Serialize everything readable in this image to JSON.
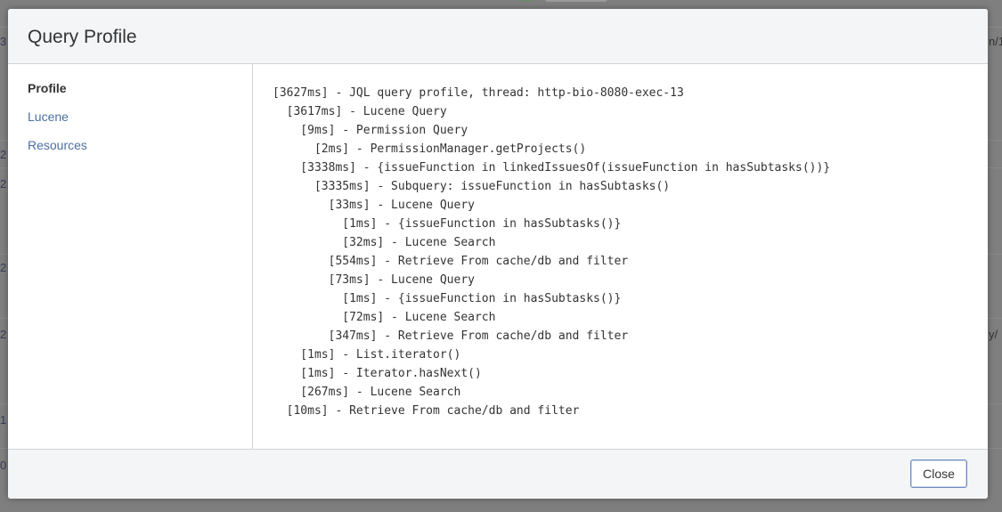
{
  "background": {
    "left_fragments": [
      "3",
      "2",
      "2",
      "2",
      "2",
      "1",
      "0"
    ],
    "right_fragments": [
      "n/1",
      "y/"
    ]
  },
  "dialog": {
    "title": "Query Profile",
    "sidebar": {
      "items": [
        {
          "label": "Profile",
          "active": true
        },
        {
          "label": "Lucene",
          "active": false
        },
        {
          "label": "Resources",
          "active": false
        }
      ]
    },
    "profile_lines": [
      "[3627ms] - JQL query profile, thread: http-bio-8080-exec-13",
      "  [3617ms] - Lucene Query",
      "    [9ms] - Permission Query",
      "      [2ms] - PermissionManager.getProjects()",
      "    [3338ms] - {issueFunction in linkedIssuesOf(issueFunction in hasSubtasks())}",
      "      [3335ms] - Subquery: issueFunction in hasSubtasks()",
      "        [33ms] - Lucene Query",
      "          [1ms] - {issueFunction in hasSubtasks()}",
      "          [32ms] - Lucene Search",
      "        [554ms] - Retrieve From cache/db and filter",
      "        [73ms] - Lucene Query",
      "          [1ms] - {issueFunction in hasSubtasks()}",
      "          [72ms] - Lucene Search",
      "        [347ms] - Retrieve From cache/db and filter",
      "    [1ms] - List.iterator()",
      "    [1ms] - Iterator.hasNext()",
      "    [267ms] - Lucene Search",
      "  [10ms] - Retrieve From cache/db and filter"
    ],
    "footer": {
      "close_label": "Close"
    }
  },
  "colors": {
    "link": "#4a6fa0",
    "text": "#333333",
    "header_bg": "#f4f5f7",
    "border": "#d0d3d8",
    "button_border": "#6e8ebc"
  }
}
